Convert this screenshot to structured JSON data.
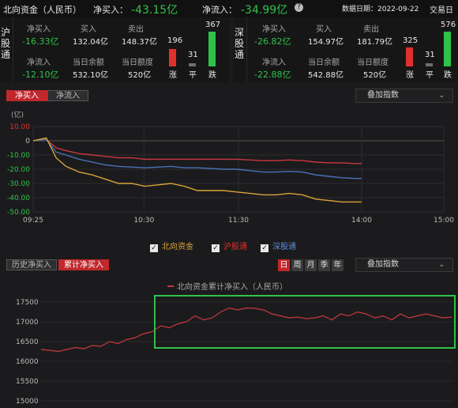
{
  "header": {
    "title": "北向资金（人民币）",
    "net_buy_label": "净买入：",
    "net_buy_value": "-43.15亿",
    "net_inflow_label": "净流入：",
    "net_inflow_value": "-34.99亿",
    "help_icon": "help-circle-icon",
    "date_label": "数据日期：2022-09-22",
    "trading_day_label": "交易日"
  },
  "hu": {
    "name": "沪股通",
    "net_buy_label": "净买入",
    "net_buy_value": "-16.33亿",
    "buy_label": "买入",
    "buy_value": "132.04亿",
    "sell_label": "卖出",
    "sell_value": "148.37亿",
    "net_inflow_label": "净流入",
    "net_inflow_value": "-12.10亿",
    "balance_label": "当日余额",
    "balance_value": "532.10亿",
    "quota_label": "当日额度",
    "quota_value": "520亿",
    "up_count": "196",
    "up_label": "涨",
    "flat_count": "31",
    "flat_label": "平",
    "down_count": "367",
    "down_label": "跌"
  },
  "shen": {
    "name": "深股通",
    "net_buy_label": "净买入",
    "net_buy_value": "-26.82亿",
    "buy_label": "买入",
    "buy_value": "154.97亿",
    "sell_label": "卖出",
    "sell_value": "181.79亿",
    "net_inflow_label": "净流入",
    "net_inflow_value": "-22.88亿",
    "balance_label": "当日余额",
    "balance_value": "542.88亿",
    "quota_label": "当日额度",
    "quota_value": "520亿",
    "up_count": "325",
    "up_label": "涨",
    "flat_count": "31",
    "flat_label": "平",
    "down_count": "576",
    "down_label": "跌"
  },
  "intraday": {
    "tab_net_buy": "净买入",
    "tab_net_inflow": "净流入",
    "overlay_dropdown": "叠加指数",
    "unit_label": "(亿)",
    "legend": {
      "north": "北向资金",
      "hu": "沪股通",
      "shen": "深股通"
    },
    "colors": {
      "north": "#d9a43a",
      "hu": "#c8383f",
      "shen": "#4a72b8"
    }
  },
  "history": {
    "tab_history": "历史净买入",
    "tab_cumulative": "累计净买入",
    "period_buttons": [
      "日",
      "周",
      "月",
      "季",
      "年"
    ],
    "overlay_dropdown": "叠加指数",
    "legend_label": "北向资金累计净买入（人民币）",
    "highlight_color": "#2fc24a",
    "line_color": "#c8383f"
  },
  "chart_data": [
    {
      "type": "line",
      "x_ticks": [
        "09:25",
        "10:30",
        "11:30",
        "14:00",
        "15:00"
      ],
      "y_ticks": [
        "10.00",
        "0",
        "-10.00",
        "-20.00",
        "-30.00",
        "-40.00",
        "-50.00"
      ],
      "ylabel": "(亿)",
      "ylim": [
        -50,
        10
      ],
      "grid": true,
      "x": [
        0,
        0.04,
        0.07,
        0.1,
        0.14,
        0.18,
        0.22,
        0.26,
        0.3,
        0.34,
        0.38,
        0.42,
        0.46,
        0.5,
        0.54,
        0.58,
        0.62,
        0.66,
        0.7,
        0.74,
        0.78,
        0.82,
        0.86,
        0.9,
        0.94,
        0.98,
        1.0
      ],
      "series": [
        {
          "name": "沪股通",
          "values": [
            0,
            1,
            -5,
            -7,
            -9,
            -10,
            -11,
            -12,
            -12,
            -13,
            -13,
            -13,
            -13,
            -13,
            -13,
            -13,
            -13,
            -13.5,
            -14,
            -14,
            -13.5,
            -14,
            -15,
            -15.5,
            -15.5,
            -16,
            -16
          ]
        },
        {
          "name": "深股通",
          "values": [
            0,
            1,
            -8,
            -10,
            -13,
            -15,
            -17,
            -18,
            -18.5,
            -19,
            -18.5,
            -18,
            -19,
            -19,
            -19.5,
            -20,
            -20,
            -21,
            -22,
            -22,
            -21.5,
            -22,
            -24,
            -25,
            -26,
            -26.5,
            -26.5
          ]
        },
        {
          "name": "北向资金",
          "values": [
            0,
            2,
            -12,
            -18,
            -22,
            -24,
            -27,
            -30,
            -30,
            -32,
            -31,
            -30,
            -32,
            -35,
            -35,
            -35,
            -36,
            -37,
            -38,
            -38,
            -37,
            -38,
            -41,
            -42,
            -43,
            -43,
            -43
          ]
        }
      ]
    },
    {
      "type": "line",
      "title": "北向资金累计净买入（人民币）",
      "y_ticks": [
        "17500",
        "17000",
        "16500",
        "16000",
        "15500",
        "15000"
      ],
      "ylim": [
        14900,
        17700
      ],
      "series": [
        {
          "name": "北向资金累计净买入（人民币）",
          "values": [
            16300,
            16280,
            16250,
            16300,
            16350,
            16320,
            16400,
            16380,
            16500,
            16450,
            16550,
            16600,
            16700,
            16750,
            16900,
            16850,
            16950,
            17000,
            17150,
            17050,
            17100,
            17250,
            17350,
            17300,
            17350,
            17340,
            17300,
            17200,
            17150,
            17100,
            17120,
            17080,
            17100,
            17150,
            17050,
            17200,
            17150,
            17250,
            17200,
            17100,
            17150,
            17050,
            17200,
            17100,
            17150,
            17200,
            17150,
            17100,
            17120
          ]
        }
      ]
    }
  ]
}
